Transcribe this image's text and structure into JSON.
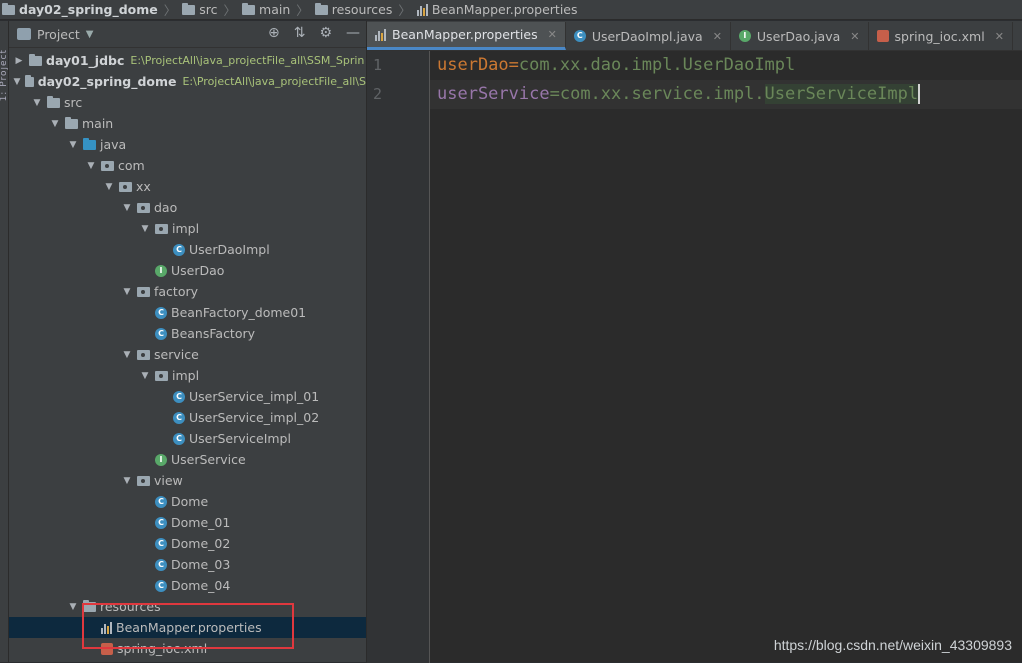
{
  "breadcrumb": {
    "items": [
      {
        "label": "day02_spring_dome",
        "icon": "folder-icon"
      },
      {
        "label": "src",
        "icon": "folder-icon"
      },
      {
        "label": "main",
        "icon": "folder-icon"
      },
      {
        "label": "resources",
        "icon": "resources-folder-icon"
      },
      {
        "label": "BeanMapper.properties",
        "icon": "properties-file-icon"
      }
    ]
  },
  "sidebar_strip": {
    "label": "1: Project"
  },
  "project_panel": {
    "title": "Project",
    "tree": [
      {
        "label": "day01_jdbc",
        "path": "E:\\ProjectAll\\java_projectFile_all\\SSM_Sprin",
        "depth": 0,
        "expanded": false,
        "bold": true,
        "icon": "module-folder-icon"
      },
      {
        "label": "day02_spring_dome",
        "path": "E:\\ProjectAll\\java_projectFile_all\\S",
        "depth": 0,
        "expanded": true,
        "bold": true,
        "icon": "module-folder-icon"
      },
      {
        "label": "src",
        "depth": 1,
        "expanded": true,
        "icon": "folder-icon"
      },
      {
        "label": "main",
        "depth": 2,
        "expanded": true,
        "icon": "folder-icon"
      },
      {
        "label": "java",
        "depth": 3,
        "expanded": true,
        "icon": "source-folder-icon"
      },
      {
        "label": "com",
        "depth": 4,
        "expanded": true,
        "icon": "package-icon"
      },
      {
        "label": "xx",
        "depth": 5,
        "expanded": true,
        "icon": "package-icon"
      },
      {
        "label": "dao",
        "depth": 6,
        "expanded": true,
        "icon": "package-icon"
      },
      {
        "label": "impl",
        "depth": 7,
        "expanded": true,
        "icon": "package-icon"
      },
      {
        "label": "UserDaoImpl",
        "depth": 8,
        "icon": "class-icon"
      },
      {
        "label": "UserDao",
        "depth": 7,
        "icon": "interface-icon"
      },
      {
        "label": "factory",
        "depth": 6,
        "expanded": true,
        "icon": "package-icon"
      },
      {
        "label": "BeanFactory_dome01",
        "depth": 7,
        "icon": "class-icon"
      },
      {
        "label": "BeansFactory",
        "depth": 7,
        "icon": "class-icon"
      },
      {
        "label": "service",
        "depth": 6,
        "expanded": true,
        "icon": "package-icon"
      },
      {
        "label": "impl",
        "depth": 7,
        "expanded": true,
        "icon": "package-icon"
      },
      {
        "label": "UserService_impl_01",
        "depth": 8,
        "icon": "class-icon"
      },
      {
        "label": "UserService_impl_02",
        "depth": 8,
        "icon": "class-icon"
      },
      {
        "label": "UserServiceImpl",
        "depth": 8,
        "icon": "class-icon"
      },
      {
        "label": "UserService",
        "depth": 7,
        "icon": "interface-icon"
      },
      {
        "label": "view",
        "depth": 6,
        "expanded": true,
        "icon": "package-icon"
      },
      {
        "label": "Dome",
        "depth": 7,
        "icon": "main-class-icon"
      },
      {
        "label": "Dome_01",
        "depth": 7,
        "icon": "main-class-icon"
      },
      {
        "label": "Dome_02",
        "depth": 7,
        "icon": "main-class-icon"
      },
      {
        "label": "Dome_03",
        "depth": 7,
        "icon": "main-class-icon"
      },
      {
        "label": "Dome_04",
        "depth": 7,
        "icon": "main-class-icon"
      },
      {
        "label": "resources",
        "depth": 3,
        "expanded": true,
        "icon": "resources-folder-icon"
      },
      {
        "label": "BeanMapper.properties",
        "depth": 4,
        "icon": "properties-file-icon",
        "selected": true
      },
      {
        "label": "spring_ioc.xml",
        "depth": 4,
        "icon": "xml-file-icon"
      }
    ]
  },
  "tabs": [
    {
      "label": "BeanMapper.properties",
      "icon": "properties-file-icon",
      "active": true
    },
    {
      "label": "UserDaoImpl.java",
      "icon": "class-icon",
      "active": false
    },
    {
      "label": "UserDao.java",
      "icon": "interface-icon",
      "active": false
    },
    {
      "label": "spring_ioc.xml",
      "icon": "xml-file-icon",
      "active": false
    }
  ],
  "editor": {
    "lines": [
      {
        "number": "1",
        "key": "userDao",
        "sep": "=",
        "value_prefix": "com.xx.dao.impl.",
        "value_highlight": "UserDaoImpl",
        "highlight": false
      },
      {
        "number": "2",
        "key": "userService",
        "sep": "=",
        "value_prefix": "com.xx.service.impl.",
        "value_highlight": "UserServiceImpl",
        "highlight": true
      }
    ]
  },
  "watermark": "https://blog.csdn.net/weixin_43309893",
  "colors": {
    "accent": "#4a88c7",
    "annotation_box": "#e0383e"
  }
}
